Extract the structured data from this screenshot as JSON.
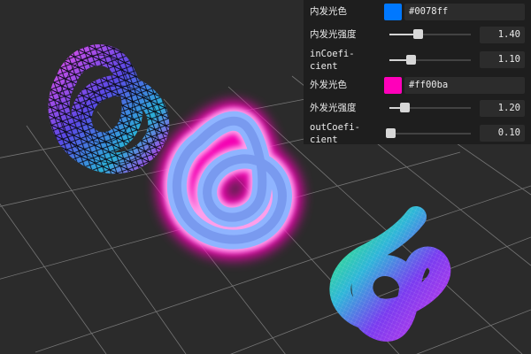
{
  "controls": [
    {
      "id": "inner-glow-color",
      "type": "color",
      "label": "内发光色",
      "value": "#0078ff",
      "swatch": "#0078ff"
    },
    {
      "id": "inner-glow-strength",
      "type": "slider",
      "label": "内发光强度",
      "value": "1.40",
      "level": 0.35
    },
    {
      "id": "in-coefficient",
      "type": "slider",
      "label": "inCoefi-\ncient",
      "value": "1.10",
      "level": 0.26
    },
    {
      "id": "outer-glow-color",
      "type": "color",
      "label": "外发光色",
      "value": "#ff00ba",
      "swatch": "#ff00ba"
    },
    {
      "id": "outer-glow-strength",
      "type": "slider",
      "label": "外发光强度",
      "value": "1.20",
      "level": 0.19
    },
    {
      "id": "out-coefficient",
      "type": "slider",
      "label": "outCoefi-\ncient",
      "value": "0.10",
      "level": 0.01
    }
  ],
  "scene": {
    "background": "#2b2b2b",
    "grid_color": "#8e8e8e",
    "objects": [
      {
        "name": "wireframe-torus-knot"
      },
      {
        "name": "glowing-torus-knot",
        "inner_glow": "#0078ff",
        "outer_glow": "#ff00ba"
      },
      {
        "name": "normal-material-torus-knot"
      }
    ]
  }
}
